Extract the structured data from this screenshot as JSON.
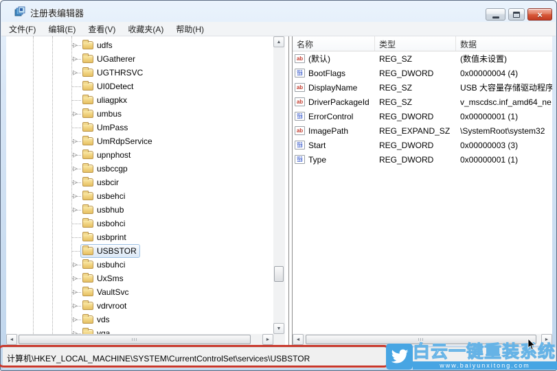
{
  "window": {
    "title": "注册表编辑器",
    "close_glyph": "×"
  },
  "menu": {
    "items": [
      {
        "label": "文件(F)"
      },
      {
        "label": "编辑(E)"
      },
      {
        "label": "查看(V)"
      },
      {
        "label": "收藏夹(A)"
      },
      {
        "label": "帮助(H)"
      }
    ]
  },
  "glyphs": {
    "expand": "▷",
    "scroll_up": "▲",
    "scroll_down": "▼",
    "scroll_left": "◄",
    "scroll_right": "►"
  },
  "tree": {
    "items": [
      {
        "label": "udfs",
        "expandable": true
      },
      {
        "label": "UGatherer",
        "expandable": true
      },
      {
        "label": "UGTHRSVC",
        "expandable": true
      },
      {
        "label": "UI0Detect",
        "expandable": false
      },
      {
        "label": "uliagpkx",
        "expandable": false
      },
      {
        "label": "umbus",
        "expandable": true
      },
      {
        "label": "UmPass",
        "expandable": false
      },
      {
        "label": "UmRdpService",
        "expandable": true
      },
      {
        "label": "upnphost",
        "expandable": true
      },
      {
        "label": "usbccgp",
        "expandable": true
      },
      {
        "label": "usbcir",
        "expandable": true
      },
      {
        "label": "usbehci",
        "expandable": true
      },
      {
        "label": "usbhub",
        "expandable": true
      },
      {
        "label": "usbohci",
        "expandable": false
      },
      {
        "label": "usbprint",
        "expandable": false
      },
      {
        "label": "USBSTOR",
        "expandable": false,
        "selected": true
      },
      {
        "label": "usbuhci",
        "expandable": true
      },
      {
        "label": "UxSms",
        "expandable": true
      },
      {
        "label": "VaultSvc",
        "expandable": true
      },
      {
        "label": "vdrvroot",
        "expandable": true
      },
      {
        "label": "vds",
        "expandable": true
      },
      {
        "label": "vga",
        "expandable": true
      }
    ]
  },
  "list": {
    "columns": [
      "名称",
      "类型",
      "数据"
    ],
    "rows": [
      {
        "icon": "string-icon",
        "name": "(默认)",
        "type": "REG_SZ",
        "data": "(数值未设置)"
      },
      {
        "icon": "dword-icon",
        "name": "BootFlags",
        "type": "REG_DWORD",
        "data": "0x00000004 (4)"
      },
      {
        "icon": "string-icon",
        "name": "DisplayName",
        "type": "REG_SZ",
        "data": "USB 大容量存储驱动程序"
      },
      {
        "icon": "string-icon",
        "name": "DriverPackageId",
        "type": "REG_SZ",
        "data": "v_mscdsc.inf_amd64_ne"
      },
      {
        "icon": "dword-icon",
        "name": "ErrorControl",
        "type": "REG_DWORD",
        "data": "0x00000001 (1)"
      },
      {
        "icon": "string-icon",
        "name": "ImagePath",
        "type": "REG_EXPAND_SZ",
        "data": "\\SystemRoot\\system32"
      },
      {
        "icon": "dword-icon",
        "name": "Start",
        "type": "REG_DWORD",
        "data": "0x00000003 (3)"
      },
      {
        "icon": "dword-icon",
        "name": "Type",
        "type": "REG_DWORD",
        "data": "0x00000001 (1)"
      }
    ]
  },
  "statusbar": {
    "path": "计算机\\HKEY_LOCAL_MACHINE\\SYSTEM\\CurrentControlSet\\services\\USBSTOR"
  },
  "annotation": {
    "type": "red-highlight-box",
    "color": "#C8372B"
  },
  "watermark": {
    "brand": "白云一键重装系统",
    "url": "www.baiyunxitong.com",
    "color": "#47A5E3"
  }
}
